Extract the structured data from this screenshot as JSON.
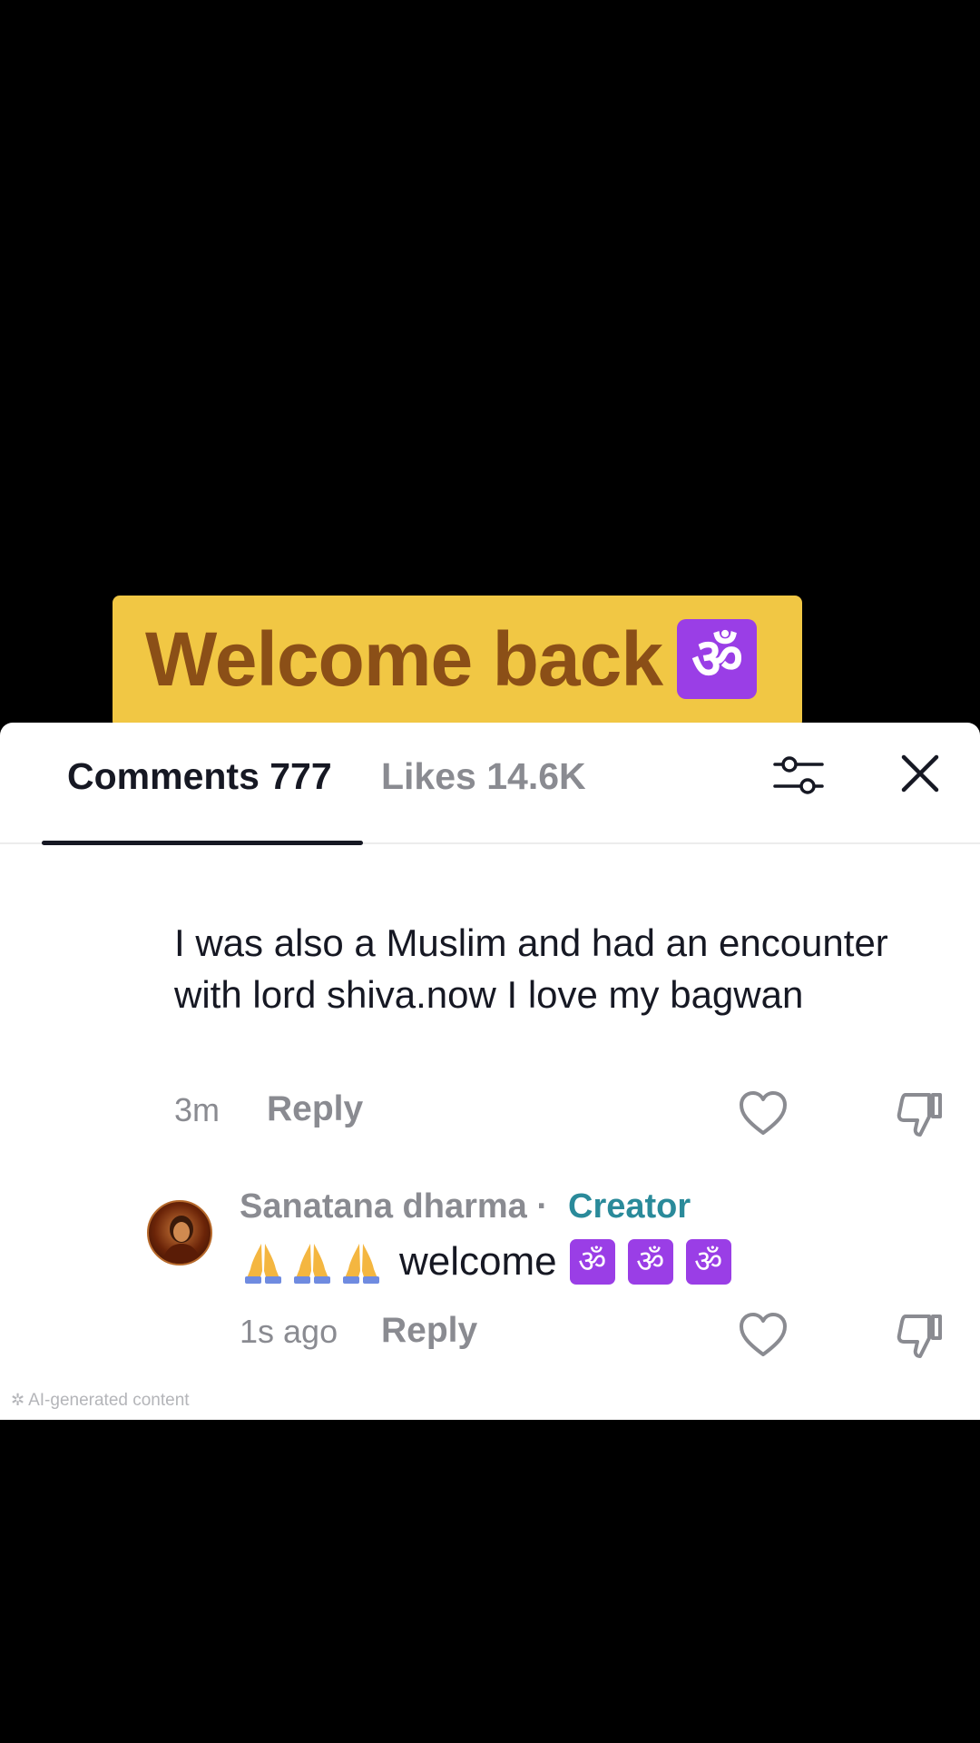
{
  "banner": {
    "text": "Welcome back",
    "emoji": "ॐ",
    "emoji_name": "om-emoji",
    "background": "#f1c744",
    "text_color": "#8b4f17"
  },
  "sheet": {
    "tabs": {
      "comments_label": "Comments 777",
      "likes_label": "Likes 14.6K"
    },
    "filter_icon": "sliders-icon",
    "close_icon": "close-icon"
  },
  "comment": {
    "text": "I was also a Muslim and had an encounter with lord shiva.now I love my bagwan",
    "time": "3m",
    "reply_label": "Reply"
  },
  "creator_reply": {
    "username": "Sanatana dharma · ",
    "badge": "Creator",
    "badge_color": "#2a8a9a",
    "text": "welcome",
    "om": "ॐ",
    "prefix_emoji_name": "folded-hands-emoji",
    "time": "1s ago",
    "reply_label": "Reply"
  },
  "footer": {
    "ai_label": "AI-generated content"
  }
}
